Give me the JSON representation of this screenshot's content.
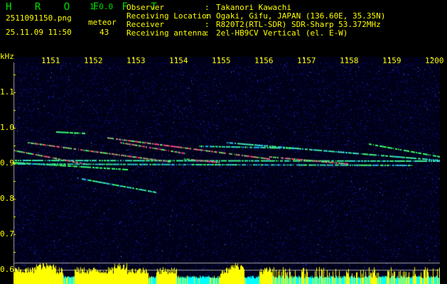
{
  "app": {
    "name": "H R O F F T",
    "version": "1.0.0"
  },
  "file": {
    "name": "2511091150.png",
    "datetime": "25.11.09 11:50"
  },
  "detection": {
    "label": "meteor",
    "count": "43"
  },
  "station": {
    "labels": [
      "Observer",
      "Receiving Location",
      "Receiver",
      "Receiving antenna"
    ],
    "separator": ":",
    "values": [
      "Takanori Kawachi",
      "Ogaki, Gifu, JAPAN (136.60E, 35.35N)",
      "R820T2(RTL-SDR) SDR-Sharp 53.372MHz",
      "2el-HB9CV Vertical (el. E-W)"
    ]
  },
  "axes": {
    "y_unit": "kHz",
    "y_ticks": [
      "1.1",
      "1.0",
      "0.9",
      "0.8",
      "0.7",
      "0.6"
    ],
    "x_ticks": [
      "1151",
      "1152",
      "1153",
      "1154",
      "1155",
      "1156",
      "1157",
      "1158",
      "1159",
      "1200"
    ]
  },
  "colors": {
    "text": "#ffff00",
    "title": "#00e000",
    "background": "#000000",
    "noise": "#10109a",
    "bar_high": "#ffff00",
    "bar_low": "#00ffff"
  }
}
